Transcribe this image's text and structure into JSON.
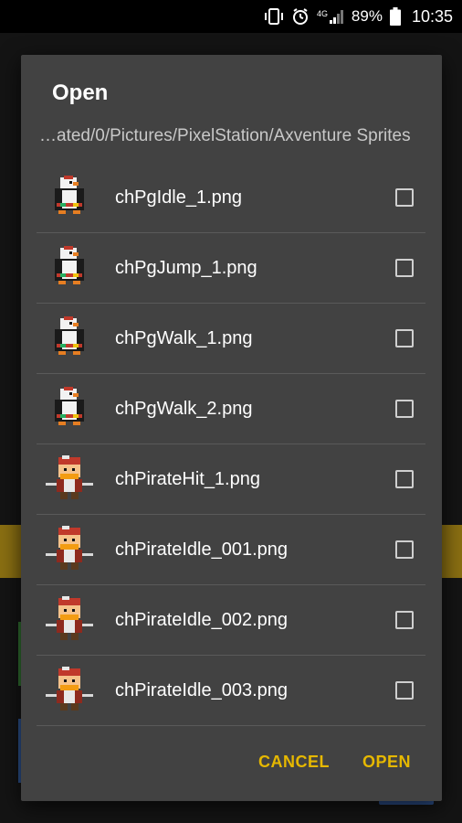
{
  "status_bar": {
    "battery_percent": "89%",
    "time": "10:35",
    "network_label": "4G"
  },
  "dialog": {
    "title": "Open",
    "path": "…ated/0/Pictures/PixelStation/Axventure Sprites",
    "files": [
      {
        "name": "chPgIdle_1.png",
        "sprite": "penguin",
        "checked": false
      },
      {
        "name": "chPgJump_1.png",
        "sprite": "penguin",
        "checked": false
      },
      {
        "name": "chPgWalk_1.png",
        "sprite": "penguin",
        "checked": false
      },
      {
        "name": "chPgWalk_2.png",
        "sprite": "penguin",
        "checked": false
      },
      {
        "name": "chPirateHit_1.png",
        "sprite": "pirate",
        "checked": false
      },
      {
        "name": "chPirateIdle_001.png",
        "sprite": "pirate",
        "checked": false
      },
      {
        "name": "chPirateIdle_002.png",
        "sprite": "pirate",
        "checked": false
      },
      {
        "name": "chPirateIdle_003.png",
        "sprite": "pirate",
        "checked": false
      }
    ],
    "cancel_label": "CANCEL",
    "open_label": "OPEN"
  },
  "colors": {
    "accent": "#e6b800",
    "dialog_bg": "#424242"
  }
}
